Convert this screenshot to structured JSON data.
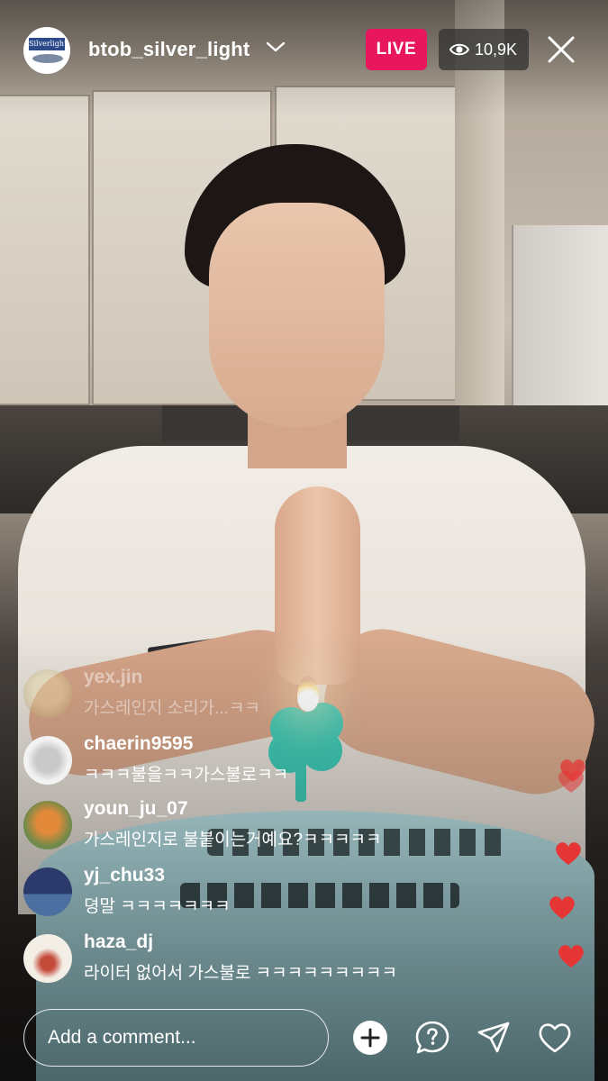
{
  "header": {
    "username": "btob_silver_light",
    "avatar_logo_text": "Silverlight",
    "live_label": "LIVE",
    "viewer_count": "10,9K"
  },
  "comments": [
    {
      "username": "yex.jin",
      "text": "가스레인지 소리가...ㅋㅋ",
      "faded": true
    },
    {
      "username": "chaerin9595",
      "text": "ㅋㅋㅋ불을ㅋㅋ가스불로ㅋㅋ",
      "faded": false
    },
    {
      "username": "youn_ju_07",
      "text": "가스레인지로 불붙이는거예요?ㅋㅋㅋㅋㅋ",
      "faded": false
    },
    {
      "username": "yj_chu33",
      "text": "뎡말 ㅋㅋㅋㅋㅋㅋㅋ",
      "faded": false
    },
    {
      "username": "haza_dj",
      "text": "라이터 없어서 가스불로 ㅋㅋㅋㅋㅋㅋㅋㅋㅋ",
      "faded": false
    }
  ],
  "composer": {
    "placeholder": "Add a comment..."
  },
  "icons": {
    "add": "plus-circle-icon",
    "question": "question-bubble-icon",
    "share": "paper-plane-icon",
    "like": "heart-icon",
    "close": "close-icon",
    "viewers": "eye-icon",
    "dropdown": "chevron-down-icon"
  },
  "colors": {
    "live_badge": "#e8175d",
    "floating_heart": "#e53535"
  }
}
